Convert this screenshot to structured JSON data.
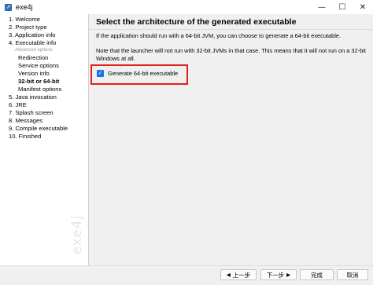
{
  "window": {
    "title": "exe4j",
    "app_icon_glyph": "⇗",
    "controls": {
      "minimize": "—",
      "maximize": "☐",
      "close": "✕"
    }
  },
  "sidebar": {
    "steps": [
      {
        "label": "1. Welcome"
      },
      {
        "label": "2. Project type"
      },
      {
        "label": "3. Application info"
      },
      {
        "label": "4. Executable info"
      },
      {
        "label": "Advanced options",
        "kind": "hint"
      },
      {
        "label": "Redirection",
        "kind": "sub"
      },
      {
        "label": "Service options",
        "kind": "sub"
      },
      {
        "label": "Version info",
        "kind": "sub"
      },
      {
        "label": "32-bit or 64-bit",
        "kind": "sub",
        "active": true
      },
      {
        "label": "Manifest options",
        "kind": "sub"
      },
      {
        "label": "5. Java invocation"
      },
      {
        "label": "6. JRE"
      },
      {
        "label": "7. Splash screen"
      },
      {
        "label": "8. Messages"
      },
      {
        "label": "9. Compile executable"
      },
      {
        "label": "10. Finished"
      }
    ],
    "brand": "exe4j"
  },
  "main": {
    "heading": "Select the architecture of the generated executable",
    "paragraph1": "If the application should run with a 64-bit JVM, you can choose to generate a 64-bit executable.",
    "paragraph2": "Note that the launcher will not run with 32-bit JVMs in that case. This means that it will not run on a 32-bit Windows at all.",
    "checkbox": {
      "label": "Generate 64-bit executable",
      "checked": true,
      "check_glyph": "✓"
    }
  },
  "footer": {
    "back": {
      "label": "上一步",
      "icon": "◀"
    },
    "next": {
      "label": "下一步",
      "icon": "▶"
    },
    "finish": {
      "label": "完成"
    },
    "cancel": {
      "label": "取消"
    }
  },
  "colors": {
    "highlight": "#e02020",
    "checkbox": "#1a73e8"
  }
}
